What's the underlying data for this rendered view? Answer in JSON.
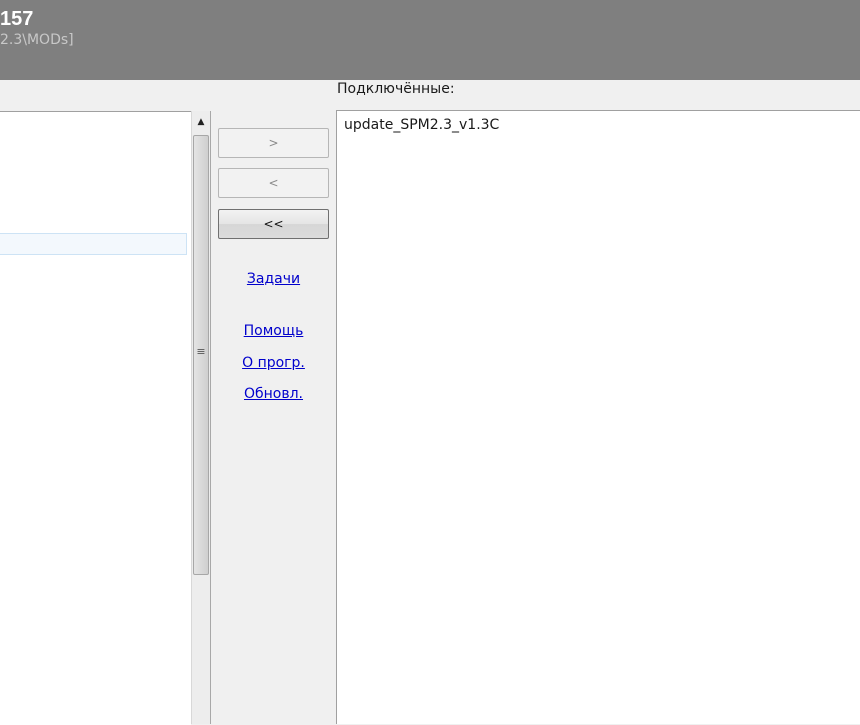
{
  "window": {
    "title": "157",
    "path": "2.3\\MODs]"
  },
  "connected": {
    "label": "Подключённые:",
    "items": [
      "update_SPM2.3_v1.3C"
    ]
  },
  "buttons": {
    "add": ">",
    "remove": "<",
    "remove_all": "<<"
  },
  "links": {
    "tasks": "Задачи",
    "help": "Помощь",
    "about": "О прогр.",
    "update": "Обновл."
  },
  "scrollbar": {
    "up_glyph": "▲",
    "grip_glyph": "≡"
  }
}
